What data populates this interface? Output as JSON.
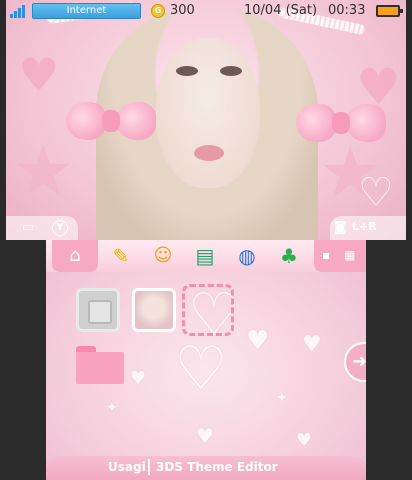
{
  "status_bar": {
    "connection": "Internet",
    "coins": "300",
    "coin_symbol": "G",
    "date": "10/04 (Sat)",
    "time": "00:33",
    "battery_color": "#f9a11b"
  },
  "top_screen": {
    "left_hint": "Y",
    "right_hint": "L+R"
  },
  "toolbar": {
    "icons": [
      "home-settings-icon",
      "pencil-icon",
      "smiley-icon",
      "speech-bubble-icon",
      "globe-icon",
      "friends-icon"
    ]
  },
  "footer": {
    "author": "Usagi",
    "app": "3DS Theme Editor"
  },
  "colors": {
    "accent": "#f7a9c3",
    "internet": "#3c9fdc"
  }
}
